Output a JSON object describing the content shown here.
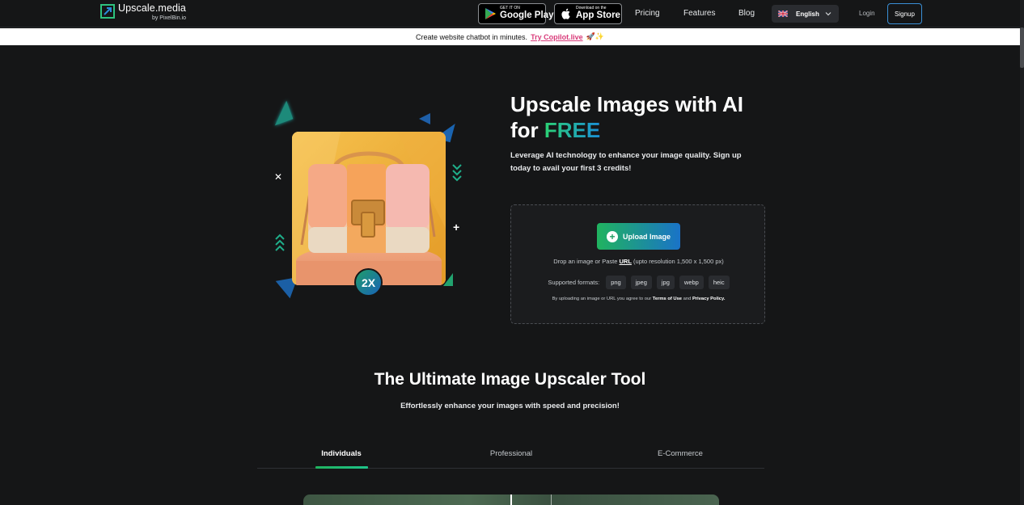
{
  "nav": {
    "logo_title": "Upscale.media",
    "logo_sub": "by PixelBin.io",
    "google_play_small": "GET IT ON",
    "google_play_big": "Google Play",
    "app_store_small": "Download on the",
    "app_store_big": "App Store",
    "links": [
      "Pricing",
      "Features",
      "Blog"
    ],
    "language": "English",
    "login": "Login",
    "signup": "Signup"
  },
  "promo": {
    "text": "Create website chatbot in minutes.",
    "link": "Try Copilot.live",
    "emoji": "🚀✨"
  },
  "hero": {
    "title_line1": "Upscale Images with AI",
    "title_for": "for ",
    "title_free": "FREE",
    "description": "Leverage AI technology to enhance your image quality. Sign up today to avail your first 3 credits!",
    "badge": "2X"
  },
  "upload": {
    "button_label": "Upload Image",
    "drop_text_before": "Drop an image or Paste ",
    "drop_text_url": "URL",
    "drop_text_after": " (upto resolution 1,500 x 1,500 px)",
    "formats_label": "Supported formats:",
    "formats": [
      "png",
      "jpeg",
      "jpg",
      "webp",
      "heic"
    ],
    "terms_before": "By uploading an image or URL you agree to our ",
    "terms_link": "Terms of Use",
    "terms_and": " and ",
    "privacy_link": "Privacy Policy."
  },
  "section": {
    "title": "The Ultimate Image Upscaler Tool",
    "subtitle": "Effortlessly enhance your images with speed and precision!",
    "tabs": [
      "Individuals",
      "Professional",
      "E-Commerce"
    ],
    "active_tab": "Individuals"
  },
  "colors": {
    "accent_green": "#20b35f",
    "accent_blue": "#1a73c8",
    "promo_link": "#d93b7a",
    "background": "#151617"
  }
}
